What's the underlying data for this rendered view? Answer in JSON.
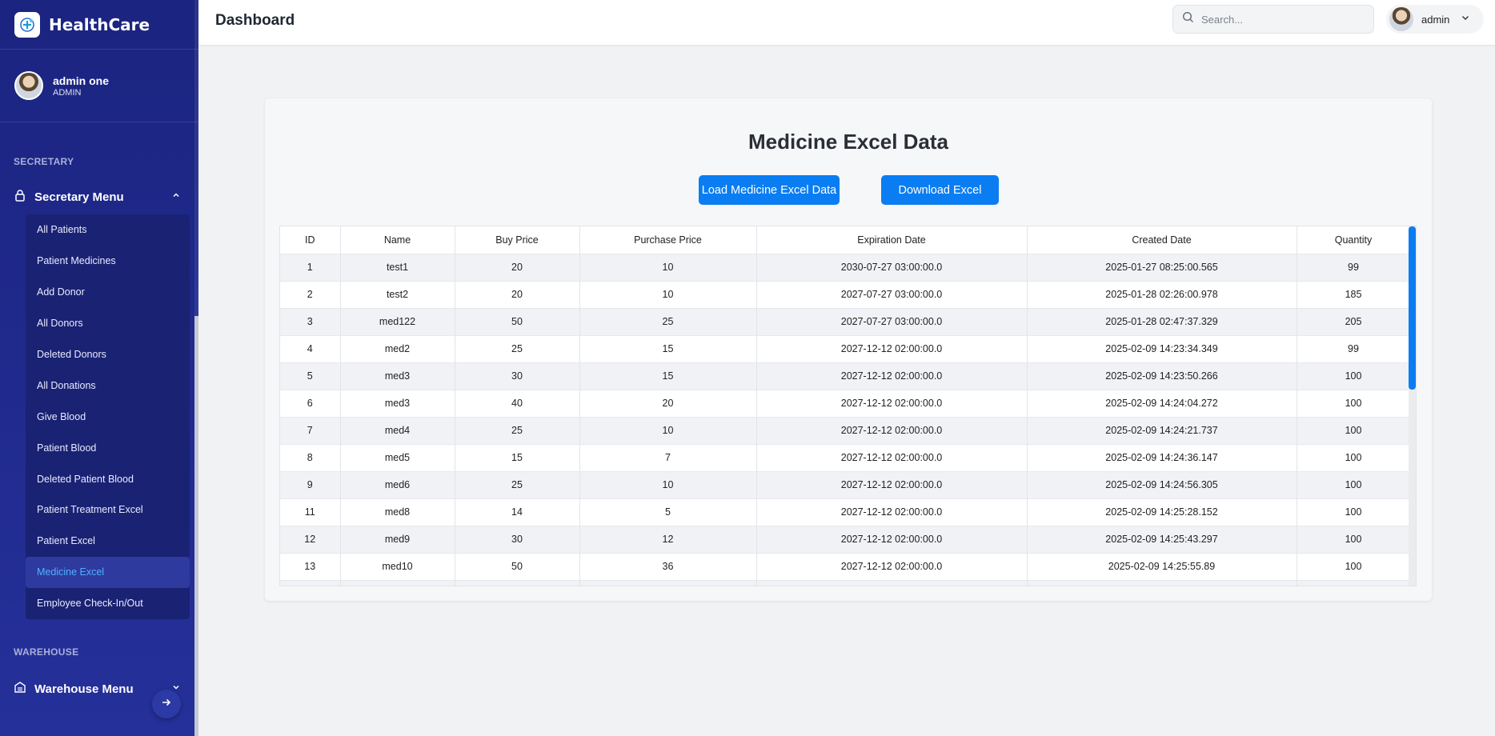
{
  "brand": {
    "name": "HealthCare"
  },
  "profile": {
    "name": "admin one",
    "role": "ADMIN"
  },
  "sidebar": {
    "section1": "SECRETARY",
    "menu1": "Secretary Menu",
    "items": [
      {
        "label": "All Patients"
      },
      {
        "label": "Patient Medicines"
      },
      {
        "label": "Add Donor"
      },
      {
        "label": "All Donors"
      },
      {
        "label": "Deleted Donors"
      },
      {
        "label": "All Donations"
      },
      {
        "label": "Give Blood"
      },
      {
        "label": "Patient Blood"
      },
      {
        "label": "Deleted Patient Blood"
      },
      {
        "label": "Patient Treatment Excel"
      },
      {
        "label": "Patient Excel"
      },
      {
        "label": "Medicine Excel",
        "active": true
      },
      {
        "label": "Employee Check-In/Out"
      }
    ],
    "section2": "WAREHOUSE",
    "menu2": "Warehouse Menu"
  },
  "header": {
    "title": "Dashboard",
    "search_placeholder": "Search...",
    "user": "admin"
  },
  "main": {
    "title": "Medicine Excel Data",
    "load_button": "Load Medicine Excel Data",
    "download_button": "Download Excel",
    "columns": [
      "ID",
      "Name",
      "Buy Price",
      "Purchase Price",
      "Expiration Date",
      "Created Date",
      "Quantity"
    ],
    "rows": [
      [
        "1",
        "test1",
        "20",
        "10",
        "2030-07-27 03:00:00.0",
        "2025-01-27 08:25:00.565",
        "99"
      ],
      [
        "2",
        "test2",
        "20",
        "10",
        "2027-07-27 03:00:00.0",
        "2025-01-28 02:26:00.978",
        "185"
      ],
      [
        "3",
        "med122",
        "50",
        "25",
        "2027-07-27 03:00:00.0",
        "2025-01-28 02:47:37.329",
        "205"
      ],
      [
        "4",
        "med2",
        "25",
        "15",
        "2027-12-12 02:00:00.0",
        "2025-02-09 14:23:34.349",
        "99"
      ],
      [
        "5",
        "med3",
        "30",
        "15",
        "2027-12-12 02:00:00.0",
        "2025-02-09 14:23:50.266",
        "100"
      ],
      [
        "6",
        "med3",
        "40",
        "20",
        "2027-12-12 02:00:00.0",
        "2025-02-09 14:24:04.272",
        "100"
      ],
      [
        "7",
        "med4",
        "25",
        "10",
        "2027-12-12 02:00:00.0",
        "2025-02-09 14:24:21.737",
        "100"
      ],
      [
        "8",
        "med5",
        "15",
        "7",
        "2027-12-12 02:00:00.0",
        "2025-02-09 14:24:36.147",
        "100"
      ],
      [
        "9",
        "med6",
        "25",
        "10",
        "2027-12-12 02:00:00.0",
        "2025-02-09 14:24:56.305",
        "100"
      ],
      [
        "11",
        "med8",
        "14",
        "5",
        "2027-12-12 02:00:00.0",
        "2025-02-09 14:25:28.152",
        "100"
      ],
      [
        "12",
        "med9",
        "30",
        "12",
        "2027-12-12 02:00:00.0",
        "2025-02-09 14:25:43.297",
        "100"
      ],
      [
        "13",
        "med10",
        "50",
        "36",
        "2027-12-12 02:00:00.0",
        "2025-02-09 14:25:55.89",
        "100"
      ],
      [
        "",
        "",
        "",
        "",
        "",
        "",
        ""
      ]
    ]
  },
  "colors": {
    "accent": "#0a7df2",
    "sidebar_bg": "#1b2480",
    "active_link": "#4fb0ff"
  },
  "icons": [
    "logo-icon",
    "lock-icon",
    "chevron-up-icon",
    "warehouse-icon",
    "chevron-down-icon",
    "arrow-right-icon",
    "search-icon"
  ]
}
